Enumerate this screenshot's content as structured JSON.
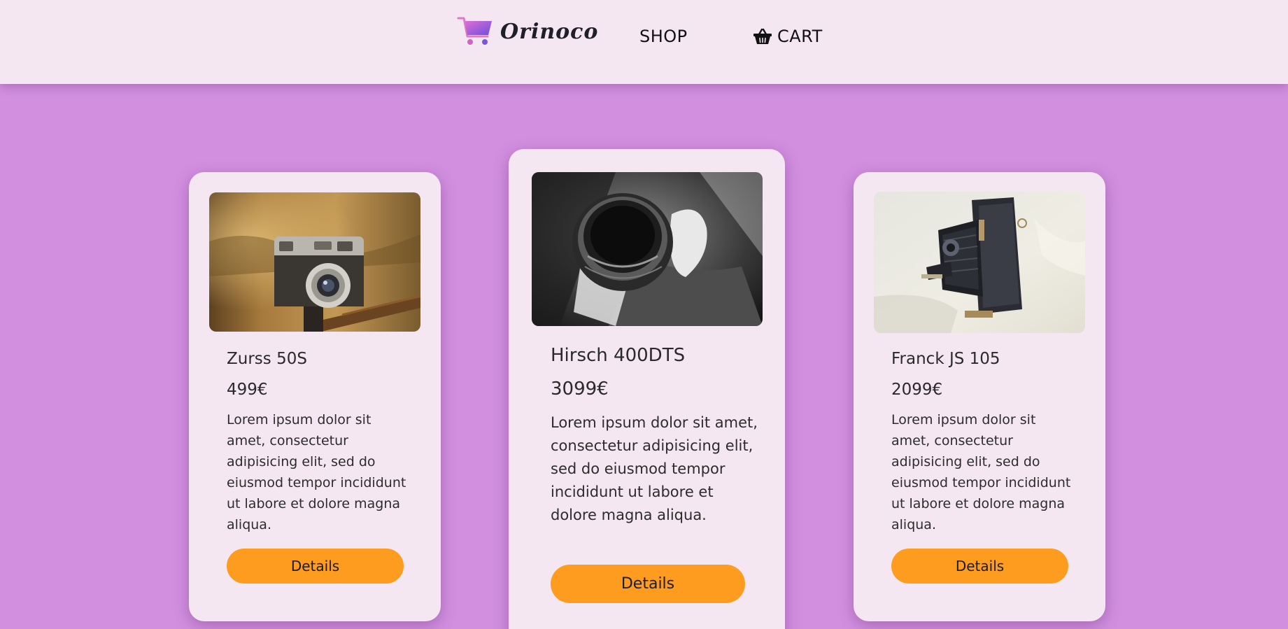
{
  "header": {
    "logo_text": "Orinoco",
    "logo_icon": "shopping-cart-icon",
    "nav": {
      "shop_label": "SHOP",
      "cart_label": "CART",
      "cart_icon": "basket-icon"
    }
  },
  "products": [
    {
      "name": "Zurss 50S",
      "price": "499€",
      "description": "Lorem ipsum dolor sit amet, consectetur adipisicing elit, sed do eiusmod tempor incididunt ut labore et dolore magna aliqua.",
      "button_label": "Details",
      "image": "vintage rangefinder camera on tripod"
    },
    {
      "name": "Hirsch 400DTS",
      "price": "3099€",
      "description": "Lorem ipsum dolor sit amet, consectetur adipisicing elit, sed do eiusmod tempor incididunt ut labore et dolore magna aliqua.",
      "button_label": "Details",
      "image": "black and white camera lens in hand"
    },
    {
      "name": "Franck JS 105",
      "price": "2099€",
      "description": "Lorem ipsum dolor sit amet, consectetur adipisicing elit, sed do eiusmod tempor incididunt ut labore et dolore magna aliqua.",
      "button_label": "Details",
      "image": "vintage folding bellows camera"
    }
  ],
  "colors": {
    "page_background": "#d28fe0",
    "header_background": "#f4e7f2",
    "card_background": "#f4e7f2",
    "button": "#fe9c20"
  }
}
